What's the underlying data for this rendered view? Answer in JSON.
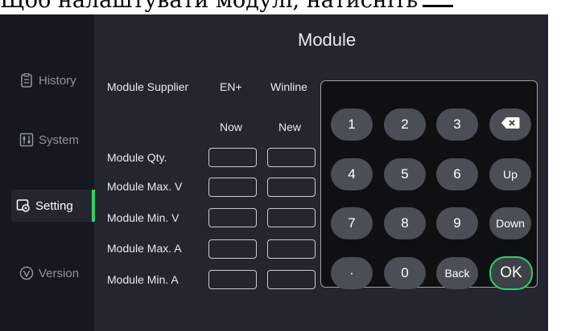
{
  "caption": "Щоб налаштувати модулі, натисніть",
  "sidebar": {
    "items": [
      {
        "label": "History",
        "icon": "history-icon"
      },
      {
        "label": "System",
        "icon": "system-icon"
      },
      {
        "label": "Setting",
        "icon": "setting-icon"
      },
      {
        "label": "Version",
        "icon": "version-icon"
      }
    ],
    "active": "Setting",
    "accent": "#2fd06a"
  },
  "page": {
    "title": "Module"
  },
  "form": {
    "supplier_label": "Module Supplier",
    "supplier_options": [
      "EN+",
      "Winline"
    ],
    "col_now": "Now",
    "col_new": "New",
    "rows": [
      {
        "label": "Module Qty.",
        "now": "",
        "new": ""
      },
      {
        "label": "Module Max. V",
        "now": "",
        "new": ""
      },
      {
        "label": "Module Min. V",
        "now": "",
        "new": ""
      },
      {
        "label": "Module Max. A",
        "now": "",
        "new": ""
      },
      {
        "label": "Module Min. A",
        "now": "",
        "new": ""
      }
    ]
  },
  "keypad": {
    "keys": [
      "1",
      "2",
      "3",
      "⌫",
      "4",
      "5",
      "6",
      "Up",
      "7",
      "8",
      "9",
      "Down",
      "·",
      "0",
      "Back",
      "OK"
    ]
  }
}
